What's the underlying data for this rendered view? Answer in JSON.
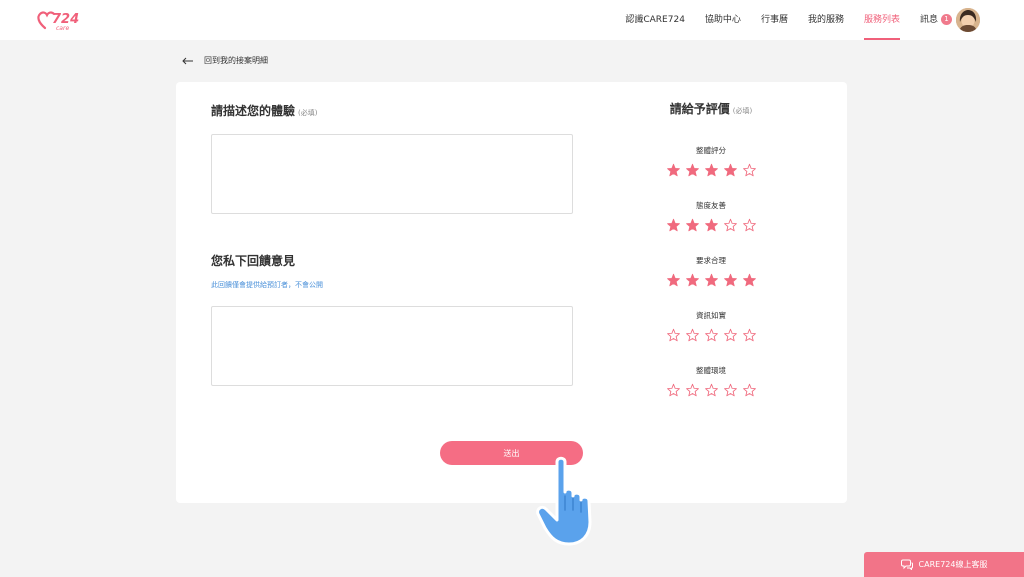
{
  "brand": {
    "logo_text": "724",
    "logo_subtext": "care"
  },
  "nav": {
    "items": [
      {
        "label": "認識CARE724",
        "active": false
      },
      {
        "label": "協助中心",
        "active": false
      },
      {
        "label": "行事曆",
        "active": false
      },
      {
        "label": "我的服務",
        "active": false
      },
      {
        "label": "服務列表",
        "active": true
      },
      {
        "label": "訊息",
        "active": false
      }
    ],
    "message_count": "1"
  },
  "back_link": {
    "label": "回到我的接案明細"
  },
  "experience": {
    "title": "請描述您的體驗",
    "required": "(必填)",
    "value": ""
  },
  "private_feedback": {
    "title": "您私下回饋意見",
    "hint": "此回饋僅會提供給預訂者，不會公開",
    "value": ""
  },
  "rating": {
    "title": "請給予評價",
    "required": "(必填)",
    "max": 5,
    "categories": [
      {
        "label": "整體評分",
        "value": 4
      },
      {
        "label": "態度友善",
        "value": 3
      },
      {
        "label": "要求合理",
        "value": 5
      },
      {
        "label": "資訊如實",
        "value": 0
      },
      {
        "label": "整體環境",
        "value": 0
      }
    ]
  },
  "submit": {
    "label": "送出"
  },
  "chat": {
    "label": "CARE724線上客服"
  },
  "colors": {
    "accent": "#f0607a",
    "star": "#f06a7e",
    "link": "#4a90d9"
  }
}
